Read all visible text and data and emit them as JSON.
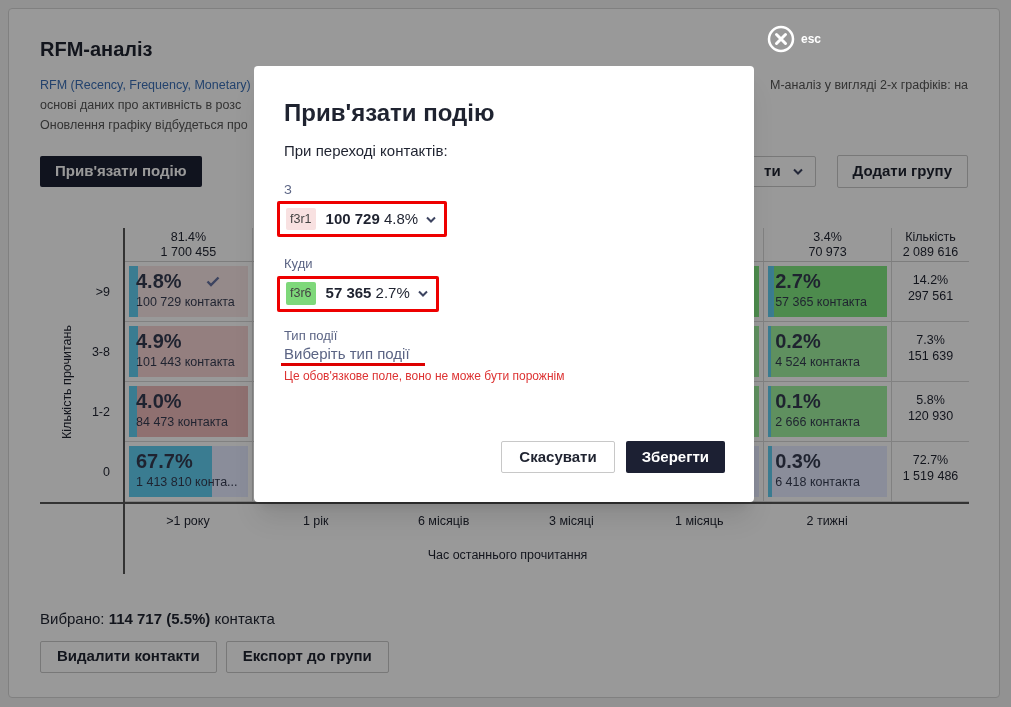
{
  "page": {
    "title": "RFM-аналіз",
    "description_left": [
      {
        "kind": "link",
        "text": "RFM (Recency, Frequency, Monetary)"
      },
      {
        "kind": "text",
        "text": "основі даних про активність в розс"
      },
      {
        "kind": "text",
        "text": "Оновлення графіку відбудеться про"
      }
    ],
    "description_right": "М-аналіз у вигляді 2-х графіків: на",
    "buttons": [
      {
        "kind": "primary",
        "label": "Прив'язати подію"
      },
      {
        "kind": "dropdown",
        "label": "ти"
      },
      {
        "kind": "outline",
        "label": "Додати групу"
      }
    ]
  },
  "grid": {
    "y_axis_title": "Кількість прочитань",
    "x_axis_title": "Час останнього прочитання",
    "rows": [
      {
        "label": ">9",
        "total_pct": "14.2%",
        "total_count": "297 561"
      },
      {
        "label": "3-8",
        "total_pct": "7.3%",
        "total_count": "151 639"
      },
      {
        "label": "1-2",
        "total_pct": "5.8%",
        "total_count": "120 930"
      },
      {
        "label": "0",
        "total_pct": "72.7%",
        "total_count": "1 519 486"
      }
    ],
    "total_header": {
      "label": "Кількість",
      "count": "2 089 616"
    },
    "columns": [
      {
        "label": ">1 року",
        "header_pct": "81.4%",
        "header_count": "1 700 455",
        "cells": [
          {
            "pct": "4.8%",
            "count": "100 729 контакта",
            "color": "#958a8a",
            "level": 0.048,
            "selected": true
          },
          {
            "pct": "4.9%",
            "count": "101 443 контакта",
            "color": "#947f7f",
            "level": 0.049,
            "selected": false
          },
          {
            "pct": "4.0%",
            "count": "84 473 контакта",
            "color": "#8f7070",
            "level": 0.04,
            "selected": false
          },
          {
            "pct": "67.7%",
            "count": "1 413 810 конта...",
            "color": "#8a8d9a",
            "level": 0.677,
            "selected": false
          }
        ]
      },
      {
        "label": "1 рік"
      },
      {
        "label": "6 місяців"
      },
      {
        "label": "3 місяці"
      },
      {
        "label": "1 місяць",
        "cells": [
          {
            "color": "#4d8b4d"
          },
          {
            "color": "#5f905f"
          },
          {
            "color": "#5f905f"
          },
          {
            "color": "#8a8d9a"
          }
        ]
      },
      {
        "label": "2 тижні",
        "header_pct": "3.4%",
        "header_count": "70 973",
        "cells": [
          {
            "pct": "2.7%",
            "count": "57 365 контакта",
            "color": "#4d8b4d",
            "level": 0.027,
            "selected": false
          },
          {
            "pct": "0.2%",
            "count": "4 524 контакта",
            "color": "#5f905f",
            "level": 0.002,
            "selected": false
          },
          {
            "pct": "0.1%",
            "count": "2 666 контакта",
            "color": "#5f905f",
            "level": 0.001,
            "selected": false
          },
          {
            "pct": "0.3%",
            "count": "6 418 контакта",
            "color": "#8a8d9a",
            "level": 0.003,
            "selected": false
          }
        ]
      }
    ]
  },
  "selection": {
    "text": "Вибрано: **114 717 (5.5%)** контакта",
    "buttons": [
      "Видалити контакти",
      "Експорт до групи"
    ]
  },
  "close": {
    "label": "esc"
  },
  "modal": {
    "title": "Прив'язати подію",
    "subtitle": "При переході контактів:",
    "fields": [
      {
        "label": "З",
        "tag": "f3r1",
        "color": "#f8e1e1",
        "count": "100 729",
        "pct": "4.8%"
      },
      {
        "label": "Куди",
        "tag": "f3r6",
        "color": "#7ed87a",
        "count": "57 365",
        "pct": "2.7%"
      }
    ],
    "event_type": {
      "label": "Тип події",
      "placeholder": "Виберіть тип події",
      "error": "Це обов'язкове поле, воно не може бути порожнім"
    },
    "buttons": [
      {
        "kind": "secondary",
        "label": "Скасувати"
      },
      {
        "kind": "primary",
        "label": "Зберегти"
      }
    ]
  }
}
